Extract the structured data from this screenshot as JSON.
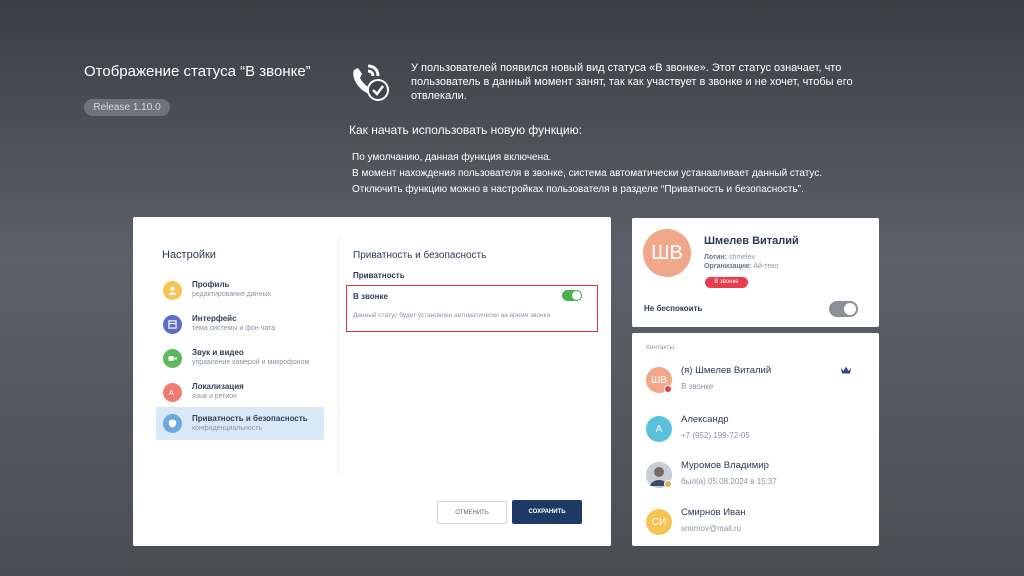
{
  "slide": {
    "title": "Отображение статуса “В звонке”",
    "release": "Release 1.10.0",
    "description": "У пользователей появился новый вид статуса «В звонке». Этот статус означает, что пользователь в данный момент занят, так как участвует в звонке и не хочет, чтобы его отвлекали.",
    "howto_title": "Как начать использовать новую функцию:",
    "howto_lines": [
      "По умолчанию, данная функция включена.",
      "В момент нахождения пользователя в звонке, система автоматически устанавливает данный статус.",
      "Отключить функцию можно в настройках пользователя в разделе “Приватность и безопасность”."
    ]
  },
  "settings": {
    "title": "Настройки",
    "nav": [
      {
        "label": "Профиль",
        "sub": "редактирование данных",
        "icon": "user-icon",
        "color": "#f5c452"
      },
      {
        "label": "Интерфейс",
        "sub": "тема системы и фон чата",
        "icon": "interface-icon",
        "color": "#5b6cc9"
      },
      {
        "label": "Звук и видео",
        "sub": "управление камерой и микрофоном",
        "icon": "video-icon",
        "color": "#5cb85c"
      },
      {
        "label": "Локализация",
        "sub": "язык и регион",
        "icon": "language-icon",
        "color": "#ef7d6f"
      },
      {
        "label": "Приватность и безопасность",
        "sub": "конфиденциальность",
        "icon": "shield-icon",
        "color": "#6fa8dc"
      }
    ],
    "section_title": "Приватность и безопасность",
    "subsection": "Приватность",
    "in_call_label": "В звонке",
    "in_call_desc": "Данный статус будет установлен автоматически на время звонка",
    "in_call_enabled": true,
    "cancel_label": "ОТМЕНИТЬ",
    "save_label": "СОХРАНИТЬ"
  },
  "profile": {
    "initials": "ШВ",
    "name": "Шмелев Виталий",
    "login_label": "Логин:",
    "login": "shmelev",
    "org_label": "Организация:",
    "org": "Ай-теко",
    "status": "В звонке",
    "dnd_label": "Не беспокоить",
    "dnd_enabled": false
  },
  "contacts": {
    "header": "Контакты:",
    "items": [
      {
        "initials": "ШВ",
        "name": "(я) Шмелев Виталий",
        "sub": "В звонке",
        "avatar_color": "#f0a78a",
        "dot_color": "#e83b4c",
        "crown": true
      },
      {
        "initials": "А",
        "name": "Александр",
        "sub": "+7 (952) 199-72-05",
        "avatar_color": "#5bc0de",
        "dot_color": "",
        "crown": false
      },
      {
        "initials": "",
        "name": "Муромов Владимир",
        "sub": "был(а) 05.08.2024 в 15:37",
        "avatar_color": "#9aa3b0",
        "dot_color": "#f0ad4e",
        "crown": false
      },
      {
        "initials": "СИ",
        "name": "Смирнов Иван",
        "sub": "smirnov@mail.ru",
        "avatar_color": "#f5c452",
        "dot_color": "",
        "crown": false
      }
    ]
  }
}
